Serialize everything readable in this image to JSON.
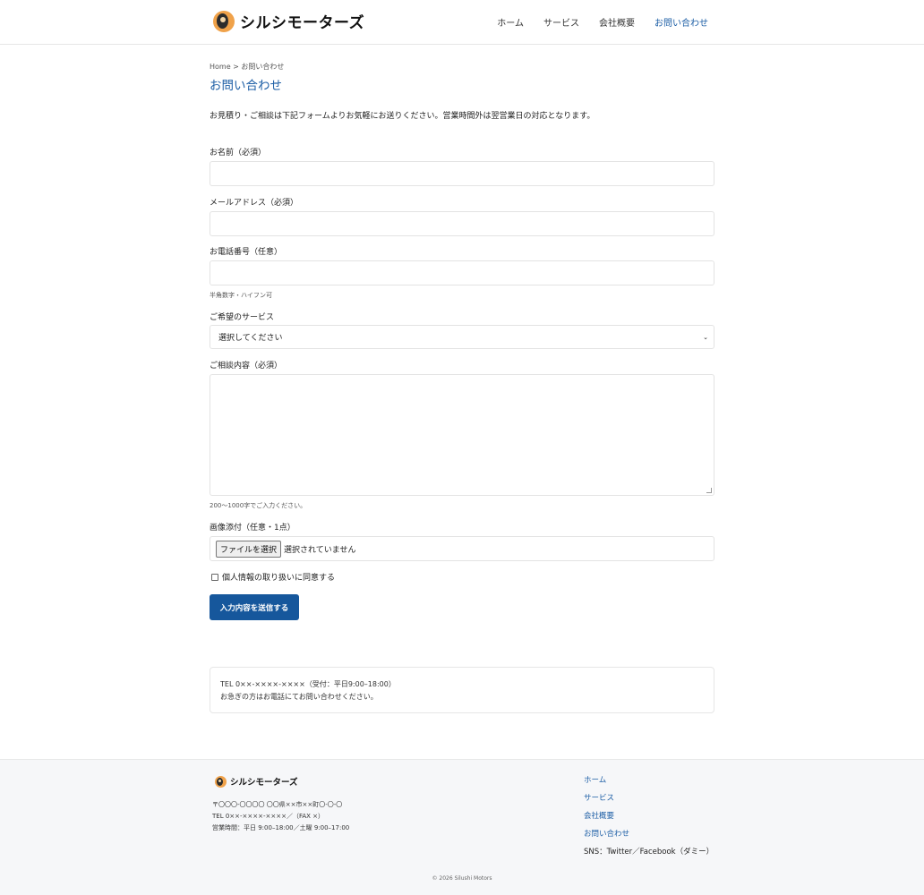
{
  "header": {
    "logo_text": "シルシモーターズ",
    "nav": [
      {
        "label": "ホーム"
      },
      {
        "label": "サービス"
      },
      {
        "label": "会社概要"
      },
      {
        "label": "お問い合わせ"
      }
    ]
  },
  "main": {
    "breadcrumb": "Home > お問い合わせ",
    "title": "お問い合わせ",
    "intro": "お見積り・ご相談は下記フォームよりお気軽にお送りください。営業時間外は翌営業日の対応となります。",
    "form": {
      "name_label": "お名前（必須）",
      "name_value": "",
      "email_label": "メールアドレス（必須）",
      "email_value": "",
      "phone_label": "お電話番号（任意）",
      "phone_value": "",
      "phone_hint": "半角数字・ハイフン可",
      "service_label": "ご希望のサービス",
      "service_selected": "選択してください",
      "message_label": "ご相談内容（必須）",
      "message_value": "",
      "message_hint": "200〜1000字でご入力ください。",
      "image_label": "画像添付（任意・1点）",
      "file_button": "ファイルを選択",
      "file_status": "選択されていません",
      "consent_label": "個人情報の取り扱いに同意する",
      "consent_checked": false,
      "submit_label": "入力内容を送信する"
    },
    "info": {
      "tel_line": "TEL 0××-××××-××××（受付：平日9:00–18:00）",
      "note": "お急ぎの方はお電話にてお問い合わせください。"
    }
  },
  "footer": {
    "logo_text": "シルシモーターズ",
    "address": "〒〇〇〇-〇〇〇〇 〇〇県××市××町〇-〇-〇",
    "tel": "TEL 0××-××××-××××／（FAX ×）",
    "hours": "営業時間：平日 9:00–18:00／土曜 9:00–17:00",
    "links": [
      {
        "label": "ホーム"
      },
      {
        "label": "サービス"
      },
      {
        "label": "会社概要"
      },
      {
        "label": "お問い合わせ"
      }
    ],
    "sns": "SNS：Twitter／Facebook（ダミー）",
    "copyright": "© 2026 Silushi Motors"
  },
  "colors": {
    "accent": "#1e5fa6",
    "button": "#16579c"
  }
}
